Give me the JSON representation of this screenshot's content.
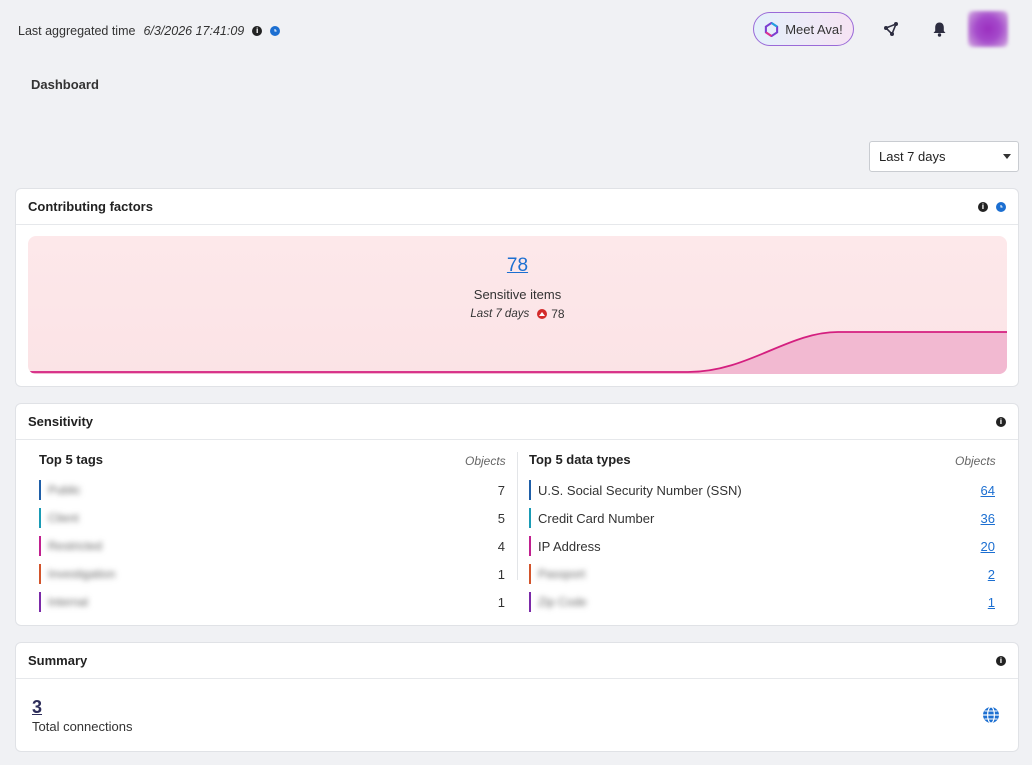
{
  "header": {
    "aggregated_label": "Last aggregated time",
    "aggregated_time": "6/3/2026 17:41:09",
    "meet_ava": "Meet Ava!",
    "icons": [
      "info-icon",
      "clock-icon",
      "share-icon",
      "bell-icon",
      "avatar"
    ]
  },
  "page": {
    "title": "Dashboard"
  },
  "filter": {
    "range": "Last 7 days"
  },
  "contributing": {
    "title": "Contributing factors",
    "count": "78",
    "label": "Sensitive items",
    "period": "Last 7 days",
    "change": "78",
    "accent": "#d41f7f"
  },
  "sensitivity": {
    "title": "Sensitivity",
    "tags": {
      "title": "Top 5 tags",
      "column": "Objects",
      "rows": [
        {
          "name": "Public",
          "count": "7",
          "color": "#1f5fa8"
        },
        {
          "name": "Client",
          "count": "5",
          "color": "#1a9bb5"
        },
        {
          "name": "Restricted",
          "count": "4",
          "color": "#c0208f"
        },
        {
          "name": "Investigation",
          "count": "1",
          "color": "#d2542b"
        },
        {
          "name": "Internal",
          "count": "1",
          "color": "#7b2aa8"
        }
      ]
    },
    "types": {
      "title": "Top 5 data types",
      "column": "Objects",
      "rows": [
        {
          "name": "U.S. Social Security Number (SSN)",
          "count": "64",
          "color": "#1f5fa8"
        },
        {
          "name": "Credit Card Number",
          "count": "36",
          "color": "#1a9bb5"
        },
        {
          "name": "IP Address",
          "count": "20",
          "color": "#c0208f"
        },
        {
          "name": "Passport",
          "count": "2",
          "color": "#d2542b"
        },
        {
          "name": "Zip Code",
          "count": "1",
          "color": "#7b2aa8"
        }
      ]
    }
  },
  "summary": {
    "title": "Summary",
    "total": "3",
    "label": "Total connections"
  }
}
